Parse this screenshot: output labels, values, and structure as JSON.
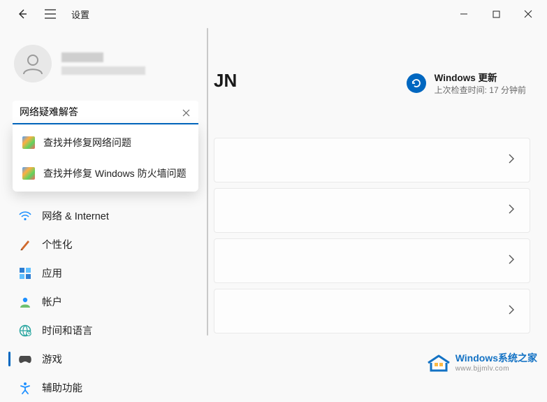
{
  "titlebar": {
    "title": "设置"
  },
  "profile": {
    "name": "████",
    "email": "████████"
  },
  "search": {
    "value": "网络疑难解答"
  },
  "suggestions": [
    {
      "label": "查找并修复网络问题"
    },
    {
      "label": "查找并修复 Windows 防火墙问题"
    }
  ],
  "nav": [
    {
      "id": "network",
      "label": "网络 & Internet",
      "icon": "wifi",
      "color": "#1e90ff"
    },
    {
      "id": "personalize",
      "label": "个性化",
      "icon": "brush",
      "color": "#d06a2e"
    },
    {
      "id": "apps",
      "label": "应用",
      "icon": "apps",
      "color": "#2d7dd2"
    },
    {
      "id": "accounts",
      "label": "帐户",
      "icon": "person",
      "color": "#1e90ff"
    },
    {
      "id": "time",
      "label": "时间和语言",
      "icon": "globe",
      "color": "#2aa6a0"
    },
    {
      "id": "gaming",
      "label": "游戏",
      "icon": "game",
      "color": "#4a4a4a"
    },
    {
      "id": "accessibility",
      "label": "辅助功能",
      "icon": "access",
      "color": "#1e90ff"
    }
  ],
  "main": {
    "title_visible_fragment": "JN",
    "update": {
      "title": "Windows 更新",
      "subtitle": "上次检查时间: 17 分钟前"
    }
  },
  "watermark": {
    "line1": "Windows系统之家",
    "line2": "www.bjjmlv.com"
  }
}
